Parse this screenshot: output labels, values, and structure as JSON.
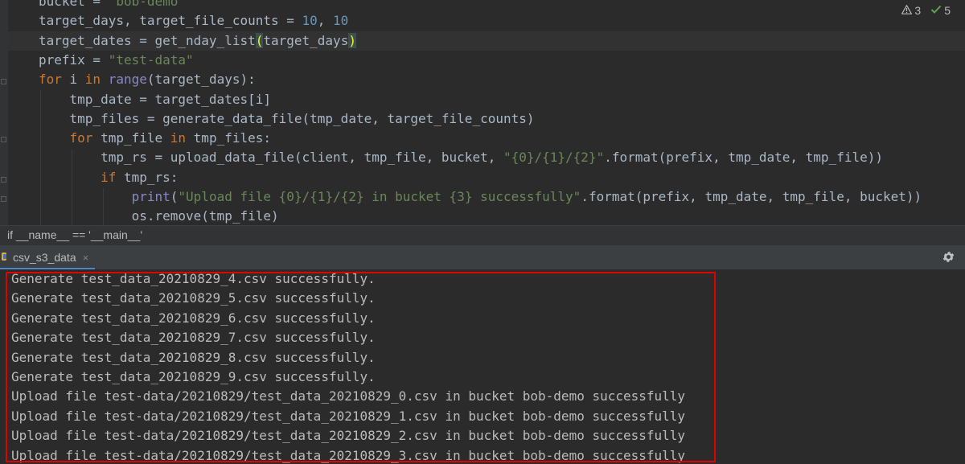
{
  "editor": {
    "lines": [
      [
        {
          "t": "bucket = "
        },
        {
          "t": "\"bob-demo\"",
          "c": "s"
        }
      ],
      [
        {
          "t": "target_days, target_file_counts = "
        },
        {
          "t": "10",
          "c": "n"
        },
        {
          "t": ", "
        },
        {
          "t": "10",
          "c": "n"
        }
      ],
      [
        {
          "t": "target_dates = get_nday_list"
        },
        {
          "t": "(",
          "c": "pm"
        },
        {
          "t": "target_days"
        },
        {
          "t": ")",
          "c": "pm"
        }
      ],
      [
        {
          "t": "prefix = "
        },
        {
          "t": "\"test-data\"",
          "c": "s"
        }
      ],
      [
        {
          "t": "for ",
          "c": "k"
        },
        {
          "t": "i "
        },
        {
          "t": "in ",
          "c": "k"
        },
        {
          "t": "range",
          "c": "bi"
        },
        {
          "t": "(target_days):"
        }
      ],
      [
        {
          "t": "    tmp_date = target_dates[i]"
        }
      ],
      [
        {
          "t": "    tmp_files = generate_data_file(tmp_date, target_file_counts)"
        }
      ],
      [
        {
          "t": "    "
        },
        {
          "t": "for ",
          "c": "k"
        },
        {
          "t": "tmp_file "
        },
        {
          "t": "in ",
          "c": "k"
        },
        {
          "t": "tmp_files:"
        }
      ],
      [
        {
          "t": "        tmp_rs = upload_data_file(client, tmp_file, bucket, "
        },
        {
          "t": "\"{0}/{1}/{2}\"",
          "c": "s"
        },
        {
          "t": ".format(prefix, tmp_date, tmp_file))"
        }
      ],
      [
        {
          "t": "        "
        },
        {
          "t": "if ",
          "c": "k"
        },
        {
          "t": "tmp_rs:"
        }
      ],
      [
        {
          "t": "            "
        },
        {
          "t": "print",
          "c": "bi"
        },
        {
          "t": "("
        },
        {
          "t": "\"Upload file {0}/{1}/{2} in bucket {3} successfully\"",
          "c": "s"
        },
        {
          "t": ".format(prefix, tmp_date, tmp_file, bucket))"
        }
      ],
      [
        {
          "t": "            os.remove(tmp_file)"
        }
      ]
    ],
    "inspection": {
      "warnings": "3",
      "ok": "5"
    },
    "breadcrumb": "if __name__ == '__main__'"
  },
  "run_panel": {
    "tab_label": "csv_s3_data",
    "tab_close": "×"
  },
  "console": {
    "lines": [
      "Generate test_data_20210829_4.csv successfully.",
      "Generate test_data_20210829_5.csv successfully.",
      "Generate test_data_20210829_6.csv successfully.",
      "Generate test_data_20210829_7.csv successfully.",
      "Generate test_data_20210829_8.csv successfully.",
      "Generate test_data_20210829_9.csv successfully.",
      "Upload file test-data/20210829/test_data_20210829_0.csv in bucket bob-demo successfully",
      "Upload file test-data/20210829/test_data_20210829_1.csv in bucket bob-demo successfully",
      "Upload file test-data/20210829/test_data_20210829_2.csv in bucket bob-demo successfully",
      "Upload file test-data/20210829/test_data_20210829_3.csv in bucket bob-demo successfully"
    ]
  },
  "colors": {
    "highlight_box": "#e00000",
    "keyword": "#cc7832",
    "string": "#6a8759",
    "number": "#6897bb"
  },
  "icons": {
    "warning": "warning-triangle-icon",
    "ok": "check-icon",
    "settings": "gear-icon",
    "run_config": "python-run-icon"
  }
}
